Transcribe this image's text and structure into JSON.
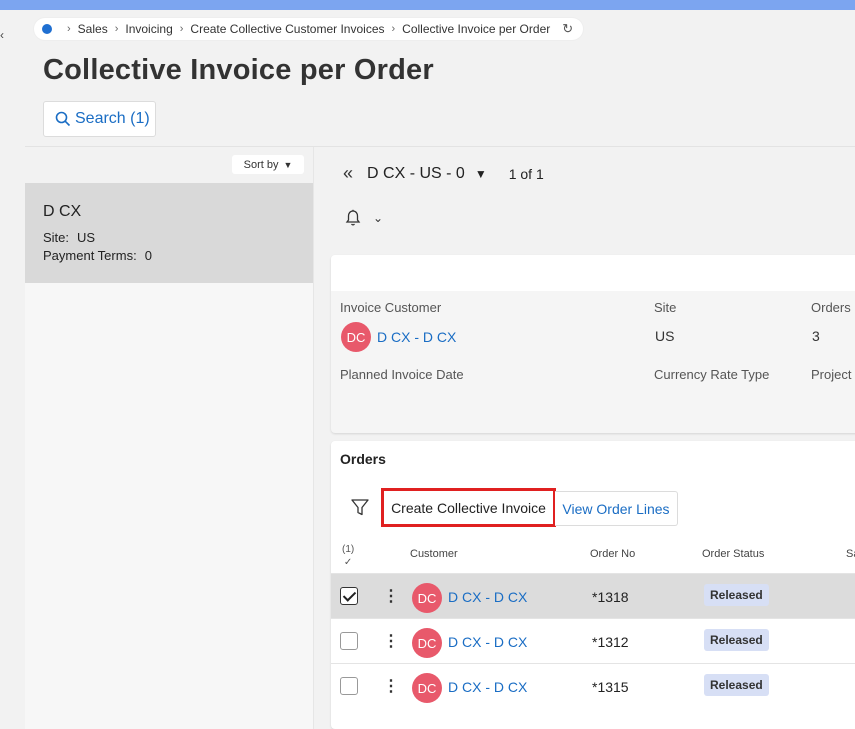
{
  "breadcrumb": {
    "items": [
      "Sales",
      "Invoicing",
      "Create Collective Customer Invoices",
      "Collective Invoice per Order"
    ]
  },
  "page": {
    "title": "Collective Invoice per Order"
  },
  "search": {
    "label": "Search (1)"
  },
  "list": {
    "sort_label": "Sort by",
    "item": {
      "title": "D CX",
      "site_label": "Site:",
      "site_value": "US",
      "terms_label": "Payment Terms:",
      "terms_value": "0"
    }
  },
  "record_nav": {
    "current": "D CX - US - 0",
    "count": "1 of 1"
  },
  "details": {
    "invoice_customer_label": "Invoice Customer",
    "invoice_customer_initials": "DC",
    "invoice_customer_value": "D CX - D CX",
    "site_label": "Site",
    "site_value": "US",
    "orders_label": "Orders",
    "orders_value": "3",
    "planned_date_label": "Planned Invoice Date",
    "currency_rate_label": "Currency Rate Type",
    "project_label": "Project"
  },
  "orders": {
    "title": "Orders",
    "create_button": "Create Collective Invoice",
    "view_lines_button": "View Order Lines",
    "selected_count": "(1)",
    "columns": {
      "customer": "Customer",
      "order_no": "Order No",
      "status": "Order Status",
      "cut": "Sa"
    },
    "rows": [
      {
        "initials": "DC",
        "customer": "D CX - D CX",
        "order_no": "*1318",
        "status": "Released",
        "selected": true
      },
      {
        "initials": "DC",
        "customer": "D CX - D CX",
        "order_no": "*1312",
        "status": "Released",
        "selected": false
      },
      {
        "initials": "DC",
        "customer": "D CX - D CX",
        "order_no": "*1315",
        "status": "Released",
        "selected": false
      }
    ]
  },
  "colors": {
    "accent": "#1a6dc4",
    "avatar": "#e8596b",
    "highlight": "#e02020",
    "badge": "#d7dff5"
  }
}
